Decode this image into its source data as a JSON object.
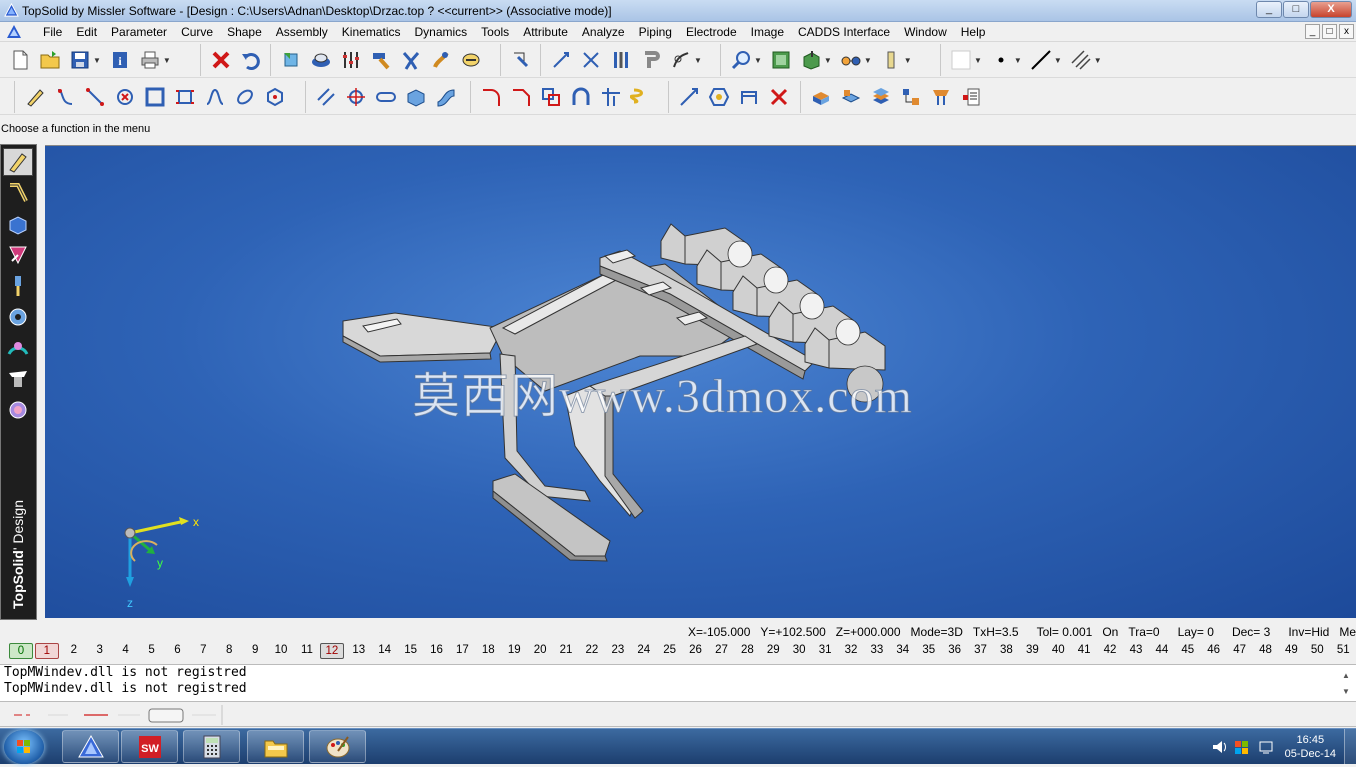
{
  "window": {
    "title": "TopSolid by Missler Software - [Design : C:\\Users\\Adnan\\Desktop\\Drzac.top ?  <<current>> (Associative mode)]",
    "controls": [
      "_",
      "□",
      "X"
    ]
  },
  "menu": {
    "items": [
      "File",
      "Edit",
      "Parameter",
      "Curve",
      "Shape",
      "Assembly",
      "Kinematics",
      "Dynamics",
      "Tools",
      "Attribute",
      "Analyze",
      "Piping",
      "Electrode",
      "Image",
      "CADDS Interface",
      "Window",
      "Help"
    ],
    "mdi_controls": [
      "_",
      "□",
      "x"
    ]
  },
  "toolbar1": {
    "icons": [
      "new-file-icon",
      "open-folder-icon",
      "save-icon",
      "info-icon",
      "print-icon",
      "delete-icon",
      "undo-icon",
      "regenerate-icon",
      "render-icon",
      "parameters-icon",
      "hammer-icon",
      "pliers-icon",
      "clamp-icon",
      "rotate-icon",
      "point-cursor-icon",
      "select-icon",
      "cut-icon",
      "bars-icon",
      "hook-icon",
      "gear-arrow-icon",
      "zoom-icon",
      "zoom-fit-icon",
      "view-cube-icon",
      "glasses-icon",
      "cylinder-icon",
      "color-swatch-icon",
      "point-style-icon",
      "line-style-icon",
      "hatch-style-icon"
    ]
  },
  "toolbar2": {
    "icons": [
      "sketch-icon",
      "curve-icon",
      "line-icon",
      "circle-point-icon",
      "rectangle-icon",
      "frame-icon",
      "spline-icon",
      "ellipse-icon",
      "polygon-icon",
      "parallel-icon",
      "target-icon",
      "slot-icon",
      "box-icon",
      "sweep-icon",
      "fillet-icon",
      "chamfer-icon",
      "offset-icon",
      "arch-icon",
      "trim-icon",
      "helix-icon",
      "dimension-icon",
      "wrap-icon",
      "bracket-icon",
      "erase-icon",
      "draft-icon",
      "sheet-icon",
      "layers-icon",
      "assembly-icon",
      "cut-tool-icon",
      "bom-icon"
    ]
  },
  "prompt": "Choose a function in the menu",
  "left_toolbar": {
    "icons": [
      "sketch-pencil-icon",
      "curve-tool-icon",
      "solid-shape-icon",
      "assembly-tool-icon",
      "drill-icon",
      "kinematics-icon",
      "tools-icon",
      "layer-stack-icon",
      "analyze-icon"
    ],
    "brand_bold": "TopSolid",
    "brand_rest": "' Design"
  },
  "viewport": {
    "watermark": "莫西网www.3dmox.com",
    "background": "#2e63b6",
    "axes": {
      "x": "x",
      "y": "y",
      "z": "z"
    }
  },
  "status": {
    "x": "X=-105.000",
    "y": "Y=+102.500",
    "z": "Z=+000.000",
    "mode": "Mode=3D",
    "txh": "TxH=3.5",
    "tol": "Tol= 0.001",
    "on": "On",
    "tra": "Tra=0",
    "lay": "Lay= 0",
    "dec": "Dec= 3",
    "inv": "Inv=Hid",
    "mes": "Mes=Elt"
  },
  "layers": [
    "0",
    "1",
    "2",
    "3",
    "4",
    "5",
    "6",
    "7",
    "8",
    "9",
    "10",
    "11",
    "12",
    "13",
    "14",
    "15",
    "16",
    "17",
    "18",
    "19",
    "20",
    "21",
    "22",
    "23",
    "24",
    "25",
    "26",
    "27",
    "28",
    "29",
    "30",
    "31",
    "32",
    "33",
    "34",
    "35",
    "36",
    "37",
    "38",
    "39",
    "40",
    "41",
    "42",
    "43",
    "44",
    "45",
    "46",
    "47",
    "48",
    "49",
    "50",
    "51"
  ],
  "messages": [
    "TopMWindev.dll is not registred",
    "TopMWindev.dll is not registred"
  ],
  "taskbar": {
    "apps": [
      "topsolid-app-icon",
      "solidworks-app-icon",
      "calculator-app-icon",
      "explorer-app-icon",
      "paint-app-icon"
    ],
    "time": "16:45",
    "date": "05-Dec-14"
  }
}
